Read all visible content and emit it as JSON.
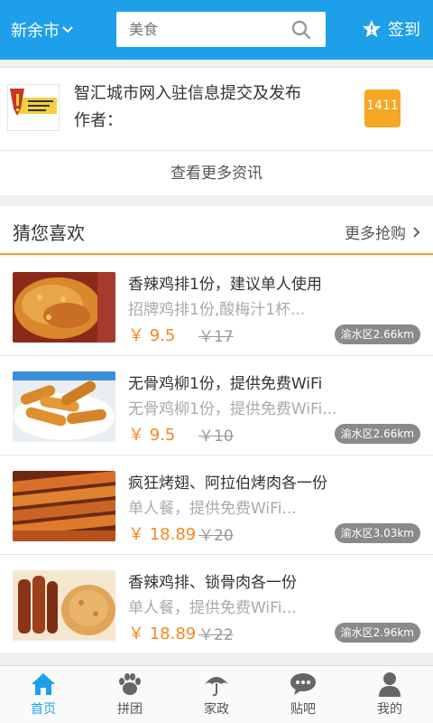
{
  "header": {
    "city": "新余市",
    "search_placeholder": "美食",
    "signin_label": "签到"
  },
  "notice": {
    "title": "智汇城市网入驻信息提交及发布",
    "author": "作者：",
    "badge": "1411",
    "more_label": "查看更多资讯"
  },
  "guess": {
    "title": "猜您喜欢",
    "more_label": "更多抢购"
  },
  "items": [
    {
      "title": "香辣鸡排1份，建议单人使用",
      "desc": "招牌鸡排1份,酸梅汁1杯...",
      "price": "￥ 9.5",
      "original": "￥17",
      "distance": "渝水区2.66km"
    },
    {
      "title": "无骨鸡柳1份，提供免费WiFi",
      "desc": "无骨鸡柳1份，提供免费WiFi...",
      "price": "￥ 9.5",
      "original": "￥10",
      "distance": "渝水区2.66km"
    },
    {
      "title": "疯狂烤翅、阿拉伯烤肉各一份",
      "desc": "单人餐，提供免费WiFi...",
      "price": "￥ 18.89",
      "original": "￥20",
      "distance": "渝水区3.03km"
    },
    {
      "title": "香辣鸡排、锁骨肉各一份",
      "desc": "单人餐，提供免费WiFi...",
      "price": "￥ 18.89",
      "original": "￥22",
      "distance": "渝水区2.96km"
    }
  ],
  "tabs": [
    {
      "label": "首页",
      "icon": "home-icon"
    },
    {
      "label": "拼团",
      "icon": "paw-icon"
    },
    {
      "label": "家政",
      "icon": "umbrella-icon"
    },
    {
      "label": "贴吧",
      "icon": "chat-icon"
    },
    {
      "label": "我的",
      "icon": "person-icon"
    }
  ],
  "colors": {
    "accent": "#1e9fea",
    "price": "#f5861f",
    "divider": "#f39c36"
  }
}
